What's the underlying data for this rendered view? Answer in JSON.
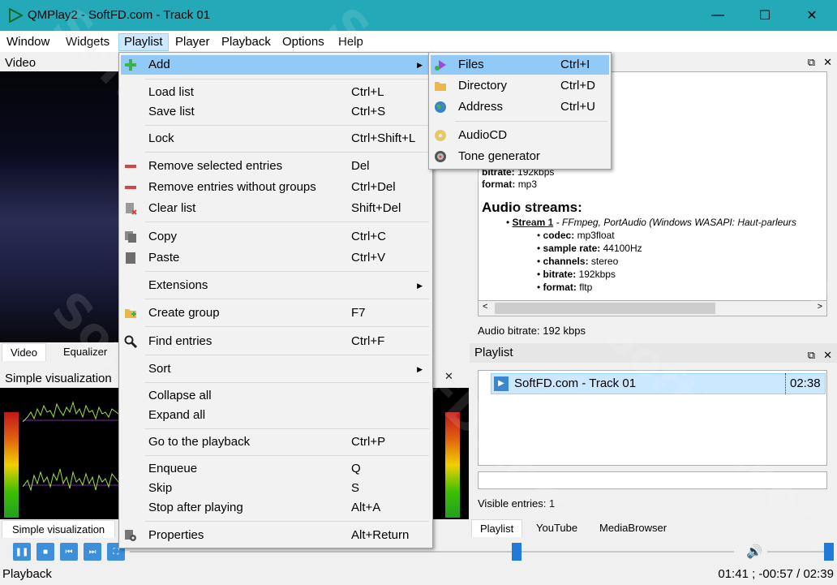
{
  "window": {
    "title": "QMPlay2 - SoftFD.com - Track 01",
    "minimize": "—",
    "maximize": "☐",
    "close": "✕"
  },
  "menubar": [
    "Window",
    "Widgets",
    "Playlist",
    "Player",
    "Playback",
    "Options",
    "Help"
  ],
  "video_dock": {
    "title": "Video",
    "tabs": [
      "Video",
      "Equalizer"
    ]
  },
  "vis_dock": {
    "title": "Simple visualization",
    "tab": "Simple visualization"
  },
  "info": {
    "bitrate_label": "bitrate:",
    "bitrate_value": "192kbps",
    "format_label": "format:",
    "format_value": "mp3",
    "audio_streams": "Audio streams:",
    "stream_name": "Stream 1",
    "stream_desc": " - FFmpeg, PortAudio (Windows WASAPI: Haut-parleurs",
    "codec_label": "codec:",
    "codec_value": "mp3float",
    "rate_label": "sample rate:",
    "rate_value": "44100Hz",
    "channels_label": "channels:",
    "channels_value": "stereo",
    "sbitrate_label": "bitrate:",
    "sbitrate_value": "192kbps",
    "sformat_label": "format:",
    "sformat_value": "fltp",
    "audio_bitrate": "Audio bitrate: 192 kbps"
  },
  "playlist_dock": {
    "title": "Playlist",
    "entries": [
      {
        "name": "SoftFD.com - Track 01",
        "length": "02:38"
      }
    ],
    "visible_entries": "Visible entries: 1",
    "tabs": [
      "Playlist",
      "YouTube",
      "MediaBrowser"
    ]
  },
  "playlist_menu": [
    {
      "label": "Add",
      "shortcut": "",
      "submenu": true,
      "icon": "plus-icon"
    },
    {
      "label": "Load list",
      "shortcut": "Ctrl+L"
    },
    {
      "label": "Save list",
      "shortcut": "Ctrl+S"
    },
    {
      "label": "Lock",
      "shortcut": "Ctrl+Shift+L"
    },
    {
      "label": "Remove selected entries",
      "shortcut": "Del",
      "icon": "minus-icon"
    },
    {
      "label": "Remove entries without groups",
      "shortcut": "Ctrl+Del",
      "icon": "minus-icon"
    },
    {
      "label": "Clear list",
      "shortcut": "Shift+Del",
      "icon": "clear-icon"
    },
    {
      "label": "Copy",
      "shortcut": "Ctrl+C",
      "icon": "copy-icon"
    },
    {
      "label": "Paste",
      "shortcut": "Ctrl+V",
      "icon": "paste-icon"
    },
    {
      "label": "Extensions",
      "shortcut": "",
      "submenu": true
    },
    {
      "label": "Create group",
      "shortcut": "F7",
      "icon": "folder-add-icon"
    },
    {
      "label": "Find entries",
      "shortcut": "Ctrl+F",
      "icon": "search-icon"
    },
    {
      "label": "Sort",
      "shortcut": "",
      "submenu": true
    },
    {
      "label": "Collapse all",
      "shortcut": ""
    },
    {
      "label": "Expand all",
      "shortcut": ""
    },
    {
      "label": "Go to the playback",
      "shortcut": "Ctrl+P"
    },
    {
      "label": "Enqueue",
      "shortcut": "Q"
    },
    {
      "label": "Skip",
      "shortcut": "S"
    },
    {
      "label": "Stop after playing",
      "shortcut": "Alt+A"
    },
    {
      "label": "Properties",
      "shortcut": "Alt+Return",
      "icon": "gear-icon"
    }
  ],
  "add_submenu": [
    {
      "label": "Files",
      "shortcut": "Ctrl+I",
      "icon": "music-file-icon"
    },
    {
      "label": "Directory",
      "shortcut": "Ctrl+D",
      "icon": "folder-icon"
    },
    {
      "label": "Address",
      "shortcut": "Ctrl+U",
      "icon": "globe-icon"
    },
    {
      "label": "AudioCD",
      "shortcut": "",
      "icon": "cd-icon"
    },
    {
      "label": "Tone generator",
      "shortcut": "",
      "icon": "tone-icon"
    }
  ],
  "status": {
    "left": "Playback",
    "right": "01:41 ; -00:57 / 02:39"
  },
  "watermark": "SoftFD.com",
  "colors": {
    "titlebar": "#23a9b8",
    "highlight": "#91c9f7",
    "selection": "#cce8ff"
  }
}
